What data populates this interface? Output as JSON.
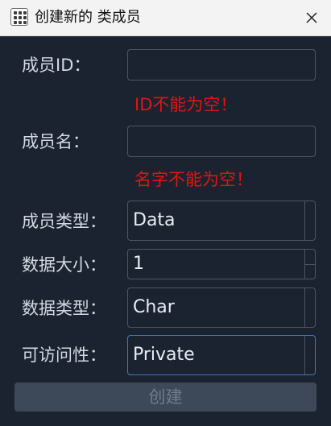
{
  "window": {
    "title": "创建新的 类成员"
  },
  "form": {
    "member_id": {
      "label": "成员ID：",
      "value": "",
      "error": "ID不能为空！"
    },
    "member_name": {
      "label": "成员名：",
      "value": "",
      "error": "名字不能为空！"
    },
    "member_type": {
      "label": "成员类型：",
      "value": "Data"
    },
    "data_size": {
      "label": "数据大小：",
      "value": "1"
    },
    "data_type": {
      "label": "数据类型：",
      "value": "Char"
    },
    "access": {
      "label": "可访问性：",
      "value": "Private"
    }
  },
  "actions": {
    "create_label": "创建"
  },
  "icons": {
    "app": "app-grid-icon",
    "close": "close-icon"
  }
}
